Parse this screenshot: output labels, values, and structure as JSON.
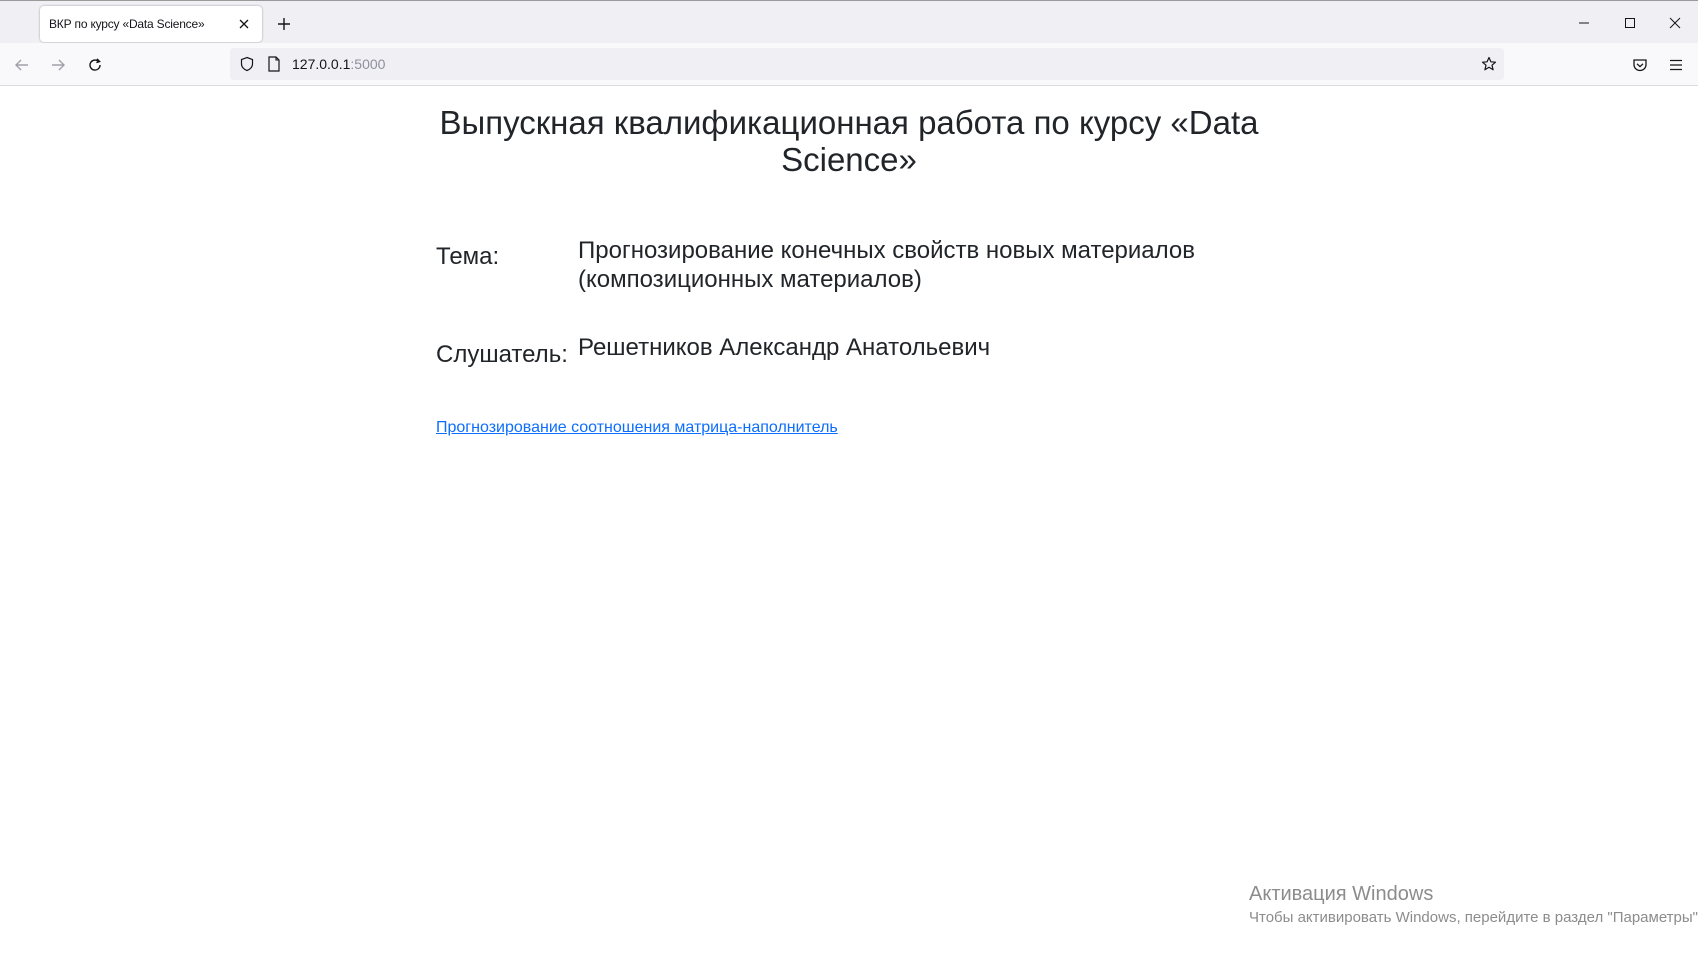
{
  "browser": {
    "tab": {
      "title": "ВКР по курсу «Data Science»"
    },
    "address": {
      "host": "127.0.0.1",
      "port": ":5000"
    },
    "icons": {
      "back": "arrow-left-icon",
      "forward": "arrow-right-icon",
      "reload": "reload-icon",
      "shield": "shield-icon",
      "page": "page-icon",
      "bookmark": "star-icon",
      "pocket": "pocket-icon",
      "menu": "hamburger-menu-icon",
      "new_tab": "plus-icon",
      "tab_close": "close-icon",
      "minimize": "minimize-icon",
      "maximize": "maximize-icon",
      "window_close": "close-icon"
    }
  },
  "page": {
    "heading": "Выпускная квалификационная работа по курсу «Data Science»",
    "topic": {
      "label": "Тема:",
      "value": "Прогнозирование конечных свойств новых материалов (композиционных материалов)"
    },
    "student": {
      "label": "Слушатель:",
      "value": "Решетников Александр Анатольевич"
    },
    "link": "Прогнозирование соотношения матрица-наполнитель"
  },
  "watermark": {
    "title": "Активация Windows",
    "subtitle": "Чтобы активировать Windows, перейдите в раздел \"Параметры\"."
  },
  "colors": {
    "link": "#0d6efd",
    "text": "#212529",
    "tabstrip": "#f0f0f4",
    "navbar": "#f9f9fb"
  }
}
